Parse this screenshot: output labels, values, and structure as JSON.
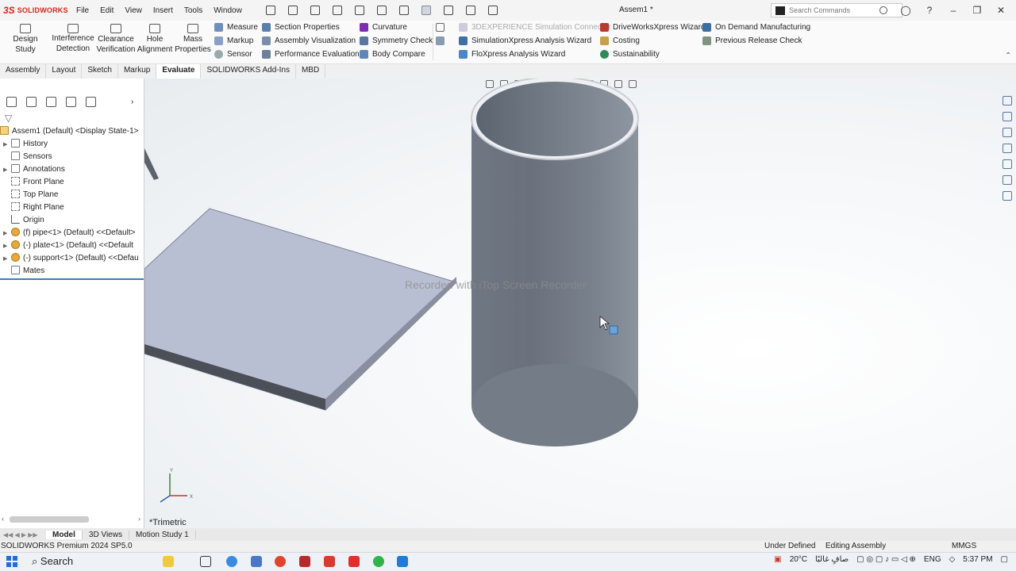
{
  "app": {
    "logo_ds": "3S",
    "logo_name": "SOLIDWORKS",
    "doc_title": "Assem1 *"
  },
  "menus": [
    "File",
    "Edit",
    "View",
    "Insert",
    "Tools",
    "Window"
  ],
  "search": {
    "placeholder": "Search Commands"
  },
  "ribbon": {
    "design_study": "Design Study",
    "interference": [
      "Interference",
      "Detection"
    ],
    "clearance": [
      "Clearance",
      "Verification"
    ],
    "hole": [
      "Hole",
      "Alignment"
    ],
    "mass": [
      "Mass",
      "Properties"
    ],
    "measure": "Measure",
    "markup": "Markup",
    "sensor": "Sensor",
    "section_properties": "Section Properties",
    "assembly_visualization": "Assembly Visualization",
    "performance_evaluation": "Performance Evaluation",
    "curvature": "Curvature",
    "symmetry_check": "Symmetry Check",
    "body_compare": "Body Compare",
    "connector": "3DEXPERIENCE Simulation Connector",
    "simxpress": "SimulationXpress Analysis Wizard",
    "floxpress": "FloXpress Analysis Wizard",
    "driveworks": "DriveWorksXpress Wizard",
    "costing": "Costing",
    "sustainability": "Sustainability",
    "on_demand": "On Demand Manufacturing",
    "previous_release": "Previous Release Check"
  },
  "tabs": [
    "Assembly",
    "Layout",
    "Sketch",
    "Markup",
    "Evaluate",
    "SOLIDWORKS Add-Ins",
    "MBD"
  ],
  "tree": {
    "root": "Assem1 (Default) <Display State-1>",
    "items": [
      "History",
      "Sensors",
      "Annotations",
      "Front Plane",
      "Top Plane",
      "Right Plane",
      "Origin",
      "(f) pipe<1> (Default) <<Default>",
      "(-) plate<1> (Default) <<Default",
      "(-) support<1> (Default) <<Defau",
      "Mates"
    ]
  },
  "viewport": {
    "watermark": "Recorded with iTop Screen Recorder",
    "view_name": "*Trimetric"
  },
  "bottom_tabs": [
    "Model",
    "3D Views",
    "Motion Study 1"
  ],
  "status": {
    "product": "SOLIDWORKS Premium 2024 SP5.0",
    "defined": "Under Defined",
    "mode": "Editing Assembly",
    "units": "MMGS"
  },
  "taskbar": {
    "search": "Search",
    "weather": "20°C",
    "weather_text": "صافٍ غالبًا",
    "lang": "ENG",
    "time": "5:37 PM"
  }
}
